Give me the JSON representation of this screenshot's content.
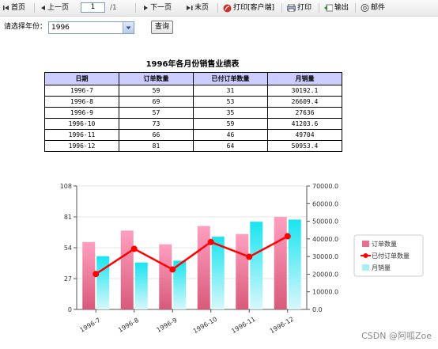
{
  "toolbar": {
    "first": "首页",
    "prev": "上一页",
    "page_value": "1",
    "page_total": "/1",
    "next": "下一页",
    "last": "末页",
    "print_client": "打印[客户端]",
    "print": "打印",
    "export": "输出",
    "mail": "邮件"
  },
  "filter": {
    "label": "请选择年份：",
    "year": "1996",
    "query": "查询"
  },
  "report": {
    "title": "1996年各月份销售业绩表",
    "columns": [
      "日期",
      "订单数量",
      "已付订单数量",
      "月销量"
    ],
    "rows": [
      [
        "1996-7",
        "59",
        "31",
        "30192.1"
      ],
      [
        "1996-8",
        "69",
        "53",
        "26609.4"
      ],
      [
        "1996-9",
        "57",
        "35",
        "27636"
      ],
      [
        "1996-10",
        "73",
        "59",
        "41203.6"
      ],
      [
        "1996-11",
        "66",
        "46",
        "49704"
      ],
      [
        "1996-12",
        "81",
        "64",
        "50953.4"
      ]
    ]
  },
  "chart_data": {
    "type": "bar",
    "categories": [
      "1996-7",
      "1996-8",
      "1996-9",
      "1996-10",
      "1996-11",
      "1996-12"
    ],
    "series": [
      {
        "name": "订单数量",
        "type": "bar",
        "axis": "left",
        "values": [
          59,
          69,
          57,
          73,
          66,
          81
        ],
        "color": "#e8708e"
      },
      {
        "name": "已付订单数量",
        "type": "line",
        "axis": "left",
        "values": [
          31,
          53,
          35,
          59,
          46,
          64
        ],
        "color": "#ff0000"
      },
      {
        "name": "月销量",
        "type": "bar",
        "axis": "right",
        "values": [
          30192.1,
          26609.4,
          27636,
          41203.6,
          49704,
          50953.4
        ],
        "color": "#22ddee"
      }
    ],
    "y_left": {
      "min": 0,
      "max": 108,
      "ticks": [
        "0",
        "27",
        "54",
        "81",
        "108"
      ]
    },
    "y_right": {
      "min": 0,
      "max": 70000,
      "ticks": [
        "0.0",
        "10000.0",
        "20000.0",
        "30000.0",
        "40000.0",
        "50000.0",
        "60000.0",
        "70000.0"
      ]
    },
    "legend": "right"
  },
  "watermark": "CSDN @阿呱Zoe"
}
